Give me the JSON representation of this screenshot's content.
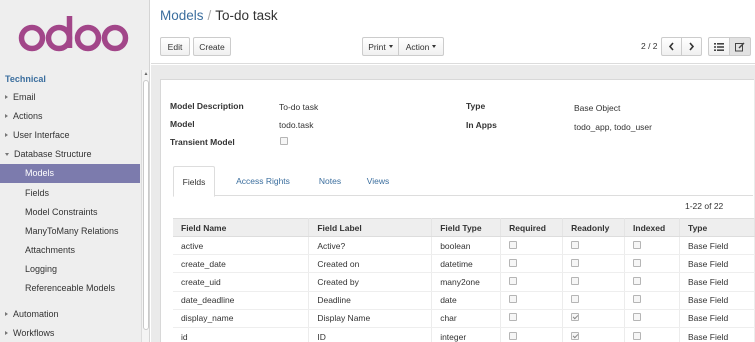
{
  "app": {
    "logo_text": "odoo",
    "brand_color": "#a24689"
  },
  "sidebar": {
    "section": "Technical",
    "items": [
      {
        "label": "Email",
        "level": 0,
        "expanded": false,
        "active": false
      },
      {
        "label": "Actions",
        "level": 0,
        "expanded": false,
        "active": false
      },
      {
        "label": "User Interface",
        "level": 0,
        "expanded": false,
        "active": false
      },
      {
        "label": "Database Structure",
        "level": 0,
        "expanded": true,
        "active": false
      },
      {
        "label": "Models",
        "level": 1,
        "active": true
      },
      {
        "label": "Fields",
        "level": 1,
        "active": false
      },
      {
        "label": "Model Constraints",
        "level": 1,
        "active": false
      },
      {
        "label": "ManyToMany Relations",
        "level": 1,
        "active": false
      },
      {
        "label": "Attachments",
        "level": 1,
        "active": false
      },
      {
        "label": "Logging",
        "level": 1,
        "active": false
      },
      {
        "label": "Referenceable Models",
        "level": 1,
        "active": false
      },
      {
        "label": "Automation",
        "level": 0,
        "expanded": false,
        "active": false
      },
      {
        "label": "Workflows",
        "level": 0,
        "expanded": false,
        "active": false
      }
    ],
    "active_color": "#7c7bad"
  },
  "header": {
    "breadcrumb_parent": "Models",
    "breadcrumb_separator": "/",
    "breadcrumb_current": "To-do task",
    "edit_label": "Edit",
    "create_label": "Create",
    "print_label": "Print",
    "action_label": "Action",
    "pager": "2 / 2",
    "prev_icon": "chevron-left-icon",
    "next_icon": "chevron-right-icon",
    "list_view_icon": "list-view-icon",
    "form_view_icon": "form-view-icon"
  },
  "form": {
    "model_description_label": "Model Description",
    "model_description": "To-do task",
    "model_label": "Model",
    "model": "todo.task",
    "transient_model_label": "Transient Model",
    "transient_model": false,
    "type_label": "Type",
    "type": "Base Object",
    "in_apps_label": "In Apps",
    "in_apps": "todo_app, todo_user"
  },
  "tabs": [
    {
      "label": "Fields",
      "active": true
    },
    {
      "label": "Access Rights",
      "active": false
    },
    {
      "label": "Notes",
      "active": false
    },
    {
      "label": "Views",
      "active": false
    }
  ],
  "fields_table": {
    "count": "1-22 of 22",
    "columns": [
      "Field Name",
      "Field Label",
      "Field Type",
      "Required",
      "Readonly",
      "Indexed",
      "Type"
    ],
    "rows": [
      {
        "name": "active",
        "label": "Active?",
        "type": "boolean",
        "required": false,
        "readonly": false,
        "indexed": false,
        "kind": "Base Field"
      },
      {
        "name": "create_date",
        "label": "Created on",
        "type": "datetime",
        "required": false,
        "readonly": false,
        "indexed": false,
        "kind": "Base Field"
      },
      {
        "name": "create_uid",
        "label": "Created by",
        "type": "many2one",
        "required": false,
        "readonly": false,
        "indexed": false,
        "kind": "Base Field"
      },
      {
        "name": "date_deadline",
        "label": "Deadline",
        "type": "date",
        "required": false,
        "readonly": false,
        "indexed": false,
        "kind": "Base Field"
      },
      {
        "name": "display_name",
        "label": "Display Name",
        "type": "char",
        "required": false,
        "readonly": true,
        "indexed": false,
        "kind": "Base Field"
      },
      {
        "name": "id",
        "label": "ID",
        "type": "integer",
        "required": false,
        "readonly": true,
        "indexed": false,
        "kind": "Base Field"
      }
    ]
  }
}
